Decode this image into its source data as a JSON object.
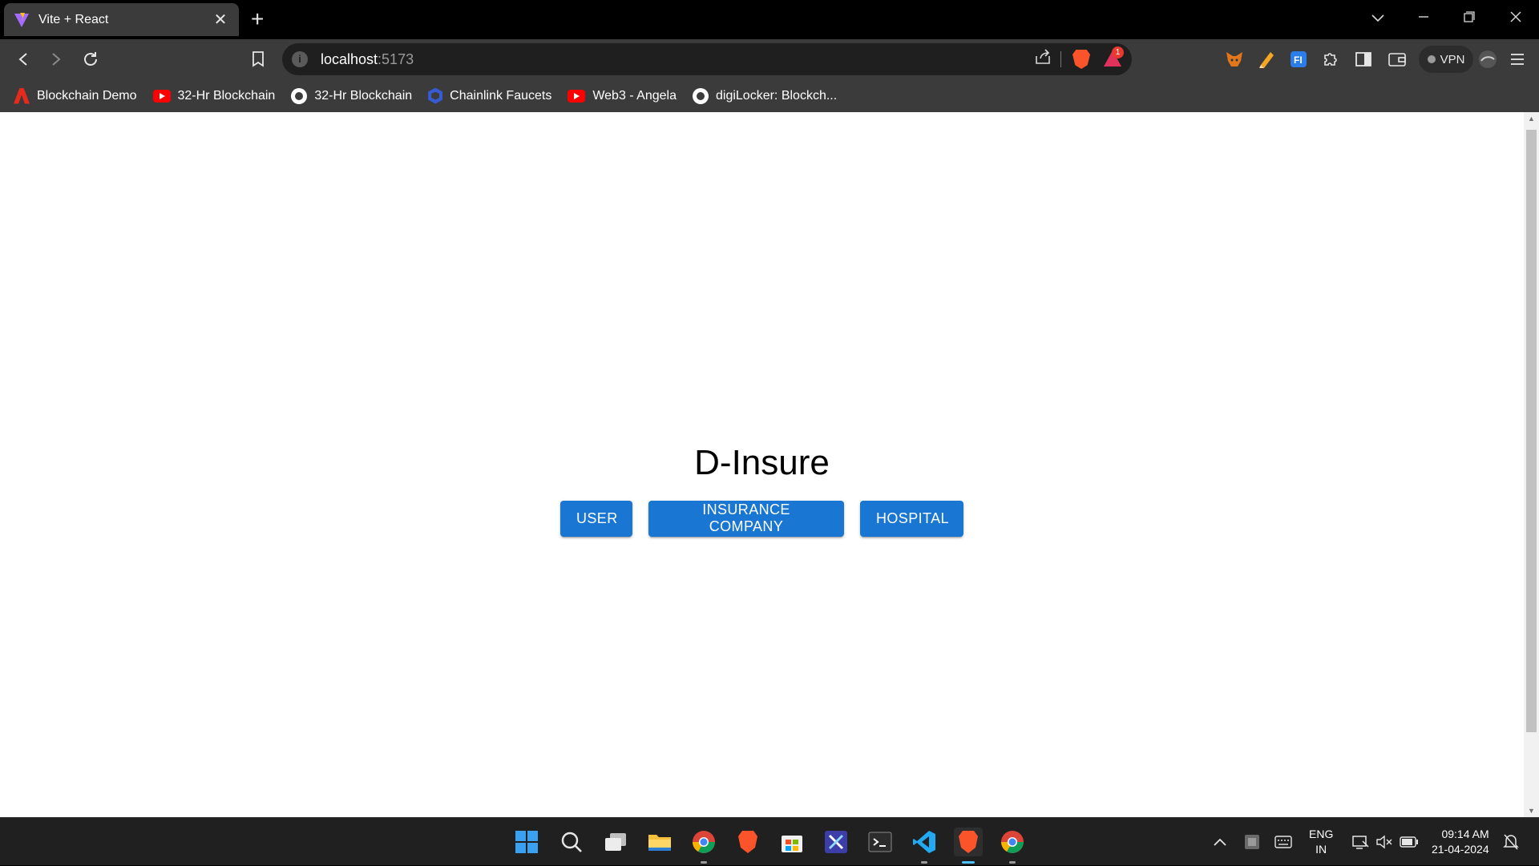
{
  "browser": {
    "tab": {
      "title": "Vite + React"
    },
    "address": {
      "host": "localhost",
      "port": ":5173"
    },
    "rewards_badge": "1",
    "vpn_label": "VPN"
  },
  "bookmarks": [
    {
      "label": "Blockchain Demo",
      "icon": "adobe-icon"
    },
    {
      "label": "32-Hr Blockchain",
      "icon": "youtube-icon"
    },
    {
      "label": "32-Hr Blockchain",
      "icon": "github-icon"
    },
    {
      "label": "Chainlink Faucets",
      "icon": "chainlink-icon"
    },
    {
      "label": "Web3 - Angela",
      "icon": "youtube-icon"
    },
    {
      "label": "digiLocker: Blockch...",
      "icon": "github-icon"
    }
  ],
  "page": {
    "heading": "D-Insure",
    "buttons": {
      "user": "USER",
      "insurance": "INSURANCE COMPANY",
      "hospital": "HOSPITAL"
    },
    "button_color": "#1976d2"
  },
  "taskbar": {
    "lang_top": "ENG",
    "lang_bottom": "IN",
    "time": "09:14 AM",
    "date": "21-04-2024"
  },
  "colors": {
    "tab_bg": "#3b3b3b",
    "titlebar_bg": "#000000",
    "taskbar_bg": "#202020",
    "accent": "#4cc2ff"
  }
}
